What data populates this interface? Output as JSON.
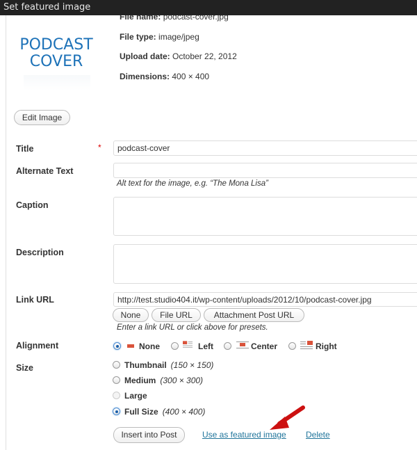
{
  "titlebar": {
    "title": "Set featured image"
  },
  "thumbnail": {
    "line1": "PODCAST",
    "line2": "COVER"
  },
  "meta": {
    "file_name_label": "File name:",
    "file_name": "podcast-cover.jpg",
    "file_type_label": "File type:",
    "file_type": "image/jpeg",
    "upload_date_label": "Upload date:",
    "upload_date": "October 22, 2012",
    "dimensions_label": "Dimensions:",
    "dimensions": "400 × 400"
  },
  "edit_image_label": "Edit Image",
  "form": {
    "title_label": "Title",
    "required_mark": "*",
    "title_value": "podcast-cover",
    "alt_label": "Alternate Text",
    "alt_value": "",
    "alt_help": "Alt text for the image, e.g. “The Mona Lisa”",
    "caption_label": "Caption",
    "caption_value": "",
    "description_label": "Description",
    "description_value": "",
    "link_label": "Link URL",
    "link_value": "http://test.studio404.it/wp-content/uploads/2012/10/podcast-cover.jpg",
    "link_buttons": [
      "None",
      "File URL",
      "Attachment Post URL"
    ],
    "link_help": "Enter a link URL or click above for presets.",
    "alignment_label": "Alignment",
    "alignment_options": [
      {
        "label": "None",
        "selected": true
      },
      {
        "label": "Left",
        "selected": false
      },
      {
        "label": "Center",
        "selected": false
      },
      {
        "label": "Right",
        "selected": false
      }
    ],
    "size_label": "Size",
    "size_options": [
      {
        "label": "Thumbnail",
        "dims": "(150 × 150)",
        "selected": false,
        "disabled": false
      },
      {
        "label": "Medium",
        "dims": "(300 × 300)",
        "selected": false,
        "disabled": false
      },
      {
        "label": "Large",
        "dims": "",
        "selected": false,
        "disabled": true
      },
      {
        "label": "Full Size",
        "dims": "(400 × 400)",
        "selected": true,
        "disabled": false
      }
    ]
  },
  "actions": {
    "insert_label": "Insert into Post",
    "featured_label": "Use as featured image",
    "delete_label": "Delete"
  },
  "colors": {
    "accent_arrow": "#cc1111",
    "link": "#21759b"
  }
}
